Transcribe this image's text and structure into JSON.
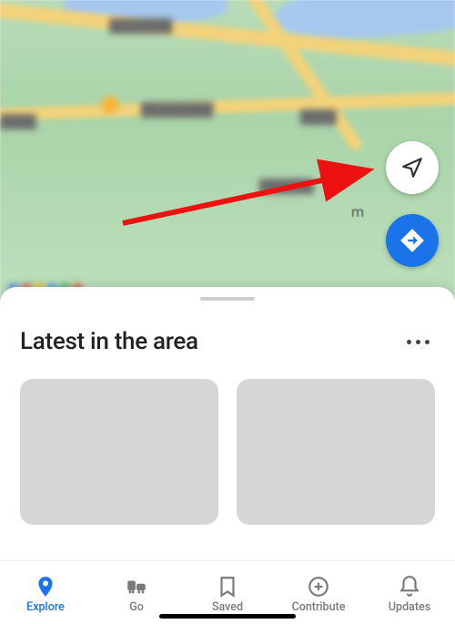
{
  "map": {
    "letter_m": "m"
  },
  "fab": {
    "locate_name": "current-location-button",
    "directions_name": "directions-button"
  },
  "sheet": {
    "title": "Latest in the area"
  },
  "nav": {
    "items": [
      {
        "label": "Explore"
      },
      {
        "label": "Go"
      },
      {
        "label": "Saved"
      },
      {
        "label": "Contribute"
      },
      {
        "label": "Updates"
      }
    ]
  },
  "colors": {
    "accent": "#1a73e8"
  }
}
